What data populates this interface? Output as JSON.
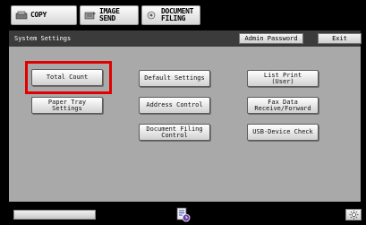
{
  "mode_tabs": [
    {
      "label": "COPY",
      "icon": "copy-icon"
    },
    {
      "label": "IMAGE SEND",
      "icon": "image-send-icon"
    },
    {
      "label": "DOCUMENT\nFILING",
      "icon": "document-filing-icon"
    }
  ],
  "header": {
    "title": "System Settings",
    "admin_password_label": "Admin Password",
    "exit_label": "Exit"
  },
  "settings_buttons": {
    "total_count": "Total Count",
    "default_settings": "Default Settings",
    "list_print": "List Print\n(User)",
    "paper_tray_settings": "Paper Tray\nSettings",
    "address_control": "Address Control",
    "fax_data": "Fax Data\nReceive/Forward",
    "document_filing_control": "Document Filing\nControl",
    "usb_device_check": "USB-Device Check"
  },
  "highlighted_item": "Total Count",
  "colors": {
    "highlight": "#e00000",
    "panel": "#a9a9a9",
    "titlebar": "#3b3b3b"
  }
}
